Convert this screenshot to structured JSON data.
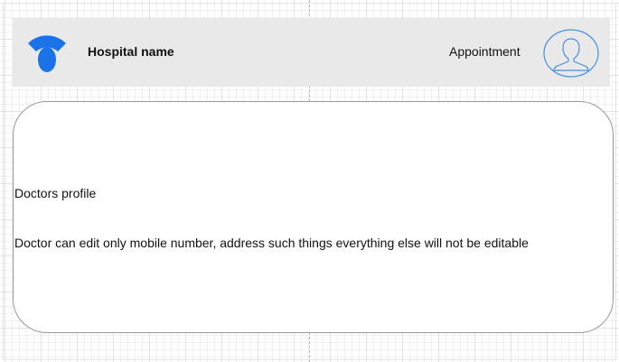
{
  "header": {
    "logo_icon": "wifi-signal-icon",
    "hospital_name": "Hospital name",
    "appointment_label": "Appointment",
    "avatar_icon": "user-avatar-icon",
    "accent_color": "#1a73e8"
  },
  "profile": {
    "title": "Doctors profile",
    "note": "Doctor can edit only mobile number, address such things everything else will not be editable"
  }
}
